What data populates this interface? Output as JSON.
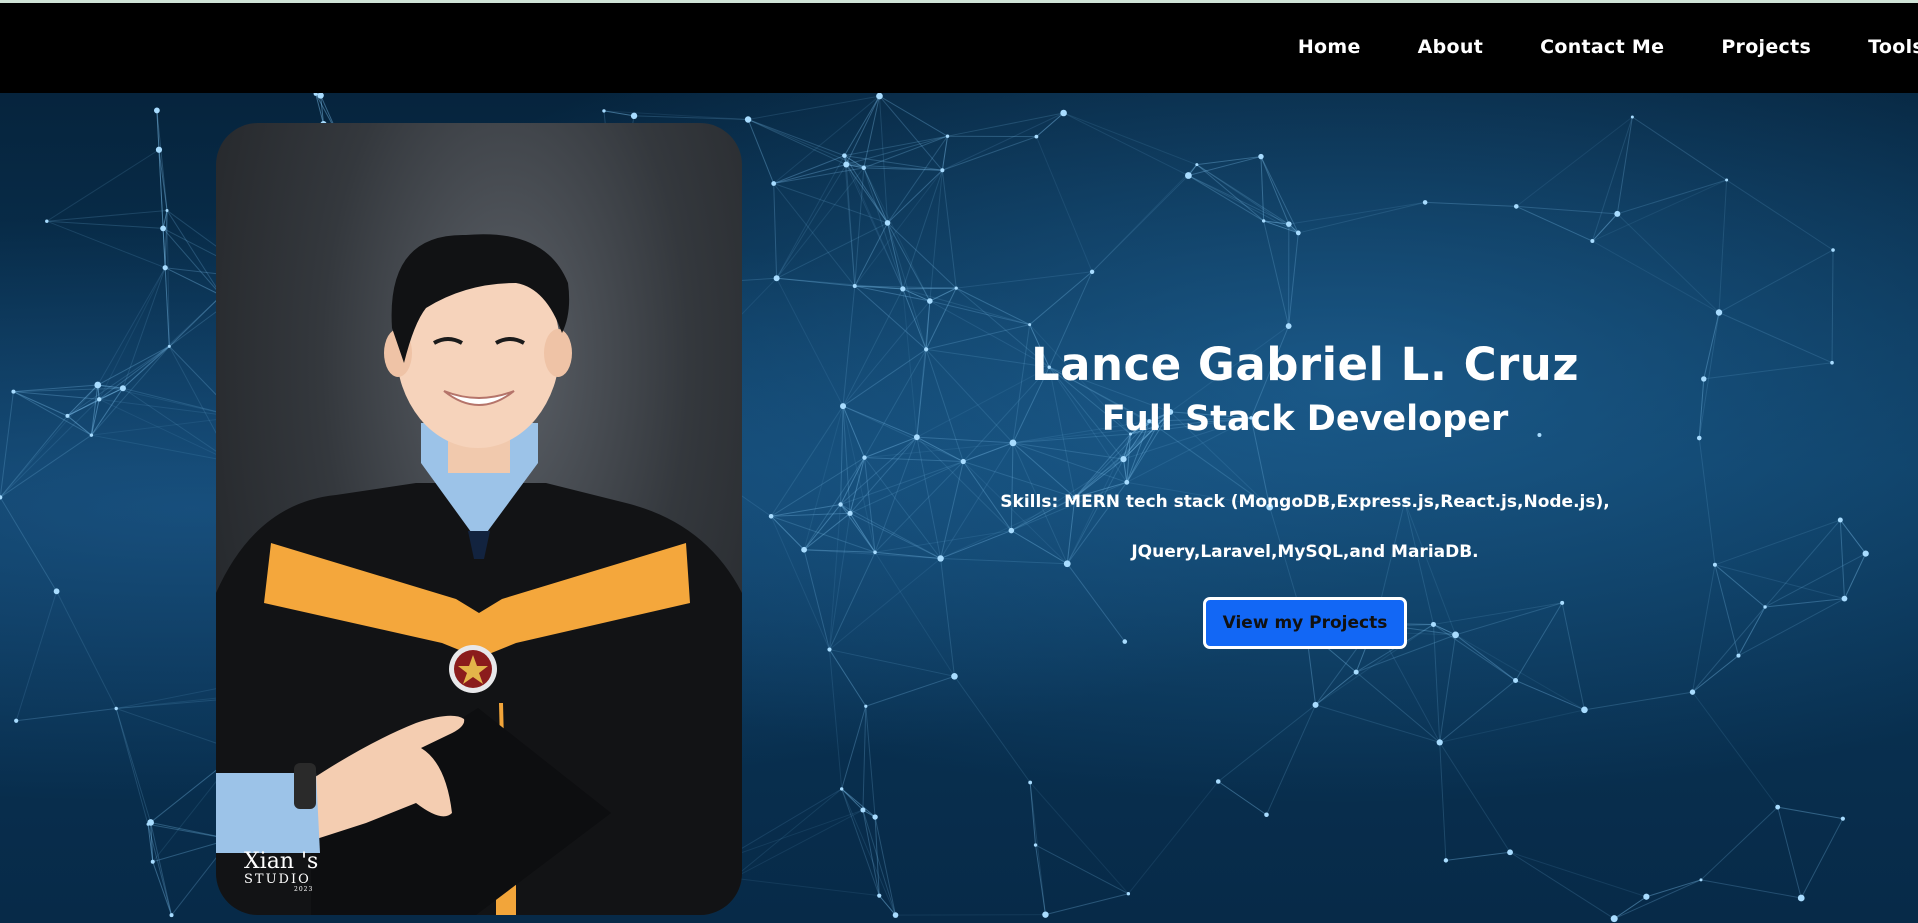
{
  "nav": {
    "items": [
      {
        "label": "Home"
      },
      {
        "label": "About"
      },
      {
        "label": "Contact Me"
      },
      {
        "label": "Projects"
      },
      {
        "label": "Tools"
      }
    ]
  },
  "hero": {
    "name": "Lance Gabriel L. Cruz",
    "role": "Full Stack Developer",
    "skills_line1": "Skills: MERN tech stack (MongoDB,Express.js,React.js,Node.js),",
    "skills_line2": "JQuery,Laravel,MySQL,and MariaDB.",
    "cta_label": "View my Projects",
    "accent_color": "#1267f5"
  },
  "photo": {
    "watermark_line1": "Xian 's",
    "watermark_line2": "STUDIO",
    "watermark_line3": "2023"
  }
}
